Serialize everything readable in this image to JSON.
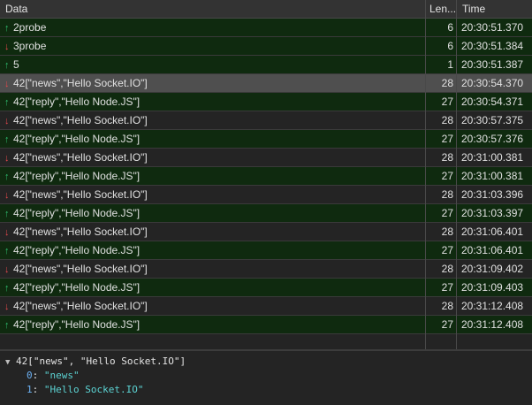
{
  "columns": {
    "data": "Data",
    "length": "Len...",
    "time": "Time"
  },
  "rows": [
    {
      "dir": "up",
      "data": "2probe",
      "length": "6",
      "time": "20:30:51.370",
      "state": "sent"
    },
    {
      "dir": "down",
      "data": "3probe",
      "length": "6",
      "time": "20:30:51.384",
      "state": "sent"
    },
    {
      "dir": "up",
      "data": "5",
      "length": "1",
      "time": "20:30:51.387",
      "state": "sent"
    },
    {
      "dir": "down",
      "data": "42[\"news\",\"Hello Socket.IO\"]",
      "length": "28",
      "time": "20:30:54.370",
      "state": "selected"
    },
    {
      "dir": "up",
      "data": "42[\"reply\",\"Hello Node.JS\"]",
      "length": "27",
      "time": "20:30:54.371",
      "state": "sent"
    },
    {
      "dir": "down",
      "data": "42[\"news\",\"Hello Socket.IO\"]",
      "length": "28",
      "time": "20:30:57.375",
      "state": "recv"
    },
    {
      "dir": "up",
      "data": "42[\"reply\",\"Hello Node.JS\"]",
      "length": "27",
      "time": "20:30:57.376",
      "state": "sent"
    },
    {
      "dir": "down",
      "data": "42[\"news\",\"Hello Socket.IO\"]",
      "length": "28",
      "time": "20:31:00.381",
      "state": "recv"
    },
    {
      "dir": "up",
      "data": "42[\"reply\",\"Hello Node.JS\"]",
      "length": "27",
      "time": "20:31:00.381",
      "state": "sent"
    },
    {
      "dir": "down",
      "data": "42[\"news\",\"Hello Socket.IO\"]",
      "length": "28",
      "time": "20:31:03.396",
      "state": "recv"
    },
    {
      "dir": "up",
      "data": "42[\"reply\",\"Hello Node.JS\"]",
      "length": "27",
      "time": "20:31:03.397",
      "state": "sent"
    },
    {
      "dir": "down",
      "data": "42[\"news\",\"Hello Socket.IO\"]",
      "length": "28",
      "time": "20:31:06.401",
      "state": "recv"
    },
    {
      "dir": "up",
      "data": "42[\"reply\",\"Hello Node.JS\"]",
      "length": "27",
      "time": "20:31:06.401",
      "state": "sent"
    },
    {
      "dir": "down",
      "data": "42[\"news\",\"Hello Socket.IO\"]",
      "length": "28",
      "time": "20:31:09.402",
      "state": "recv"
    },
    {
      "dir": "up",
      "data": "42[\"reply\",\"Hello Node.JS\"]",
      "length": "27",
      "time": "20:31:09.403",
      "state": "sent"
    },
    {
      "dir": "down",
      "data": "42[\"news\",\"Hello Socket.IO\"]",
      "length": "28",
      "time": "20:31:12.408",
      "state": "recv"
    },
    {
      "dir": "up",
      "data": "42[\"reply\",\"Hello Node.JS\"]",
      "length": "27",
      "time": "20:31:12.408",
      "state": "sent"
    }
  ],
  "details": {
    "summary": "42[\"news\", \"Hello Socket.IO\"]",
    "items": [
      {
        "key": "0",
        "value": "\"news\""
      },
      {
        "key": "1",
        "value": "\"Hello Socket.IO\""
      }
    ]
  },
  "icons": {
    "sent": "arrow-up-icon",
    "received": "arrow-down-icon",
    "expand": "triangle-down-icon"
  },
  "colors": {
    "sent_row": "#0f2a0f",
    "selected_row": "#4f4f4f",
    "up_arrow": "#2fbf71",
    "down_arrow": "#e5484d"
  }
}
